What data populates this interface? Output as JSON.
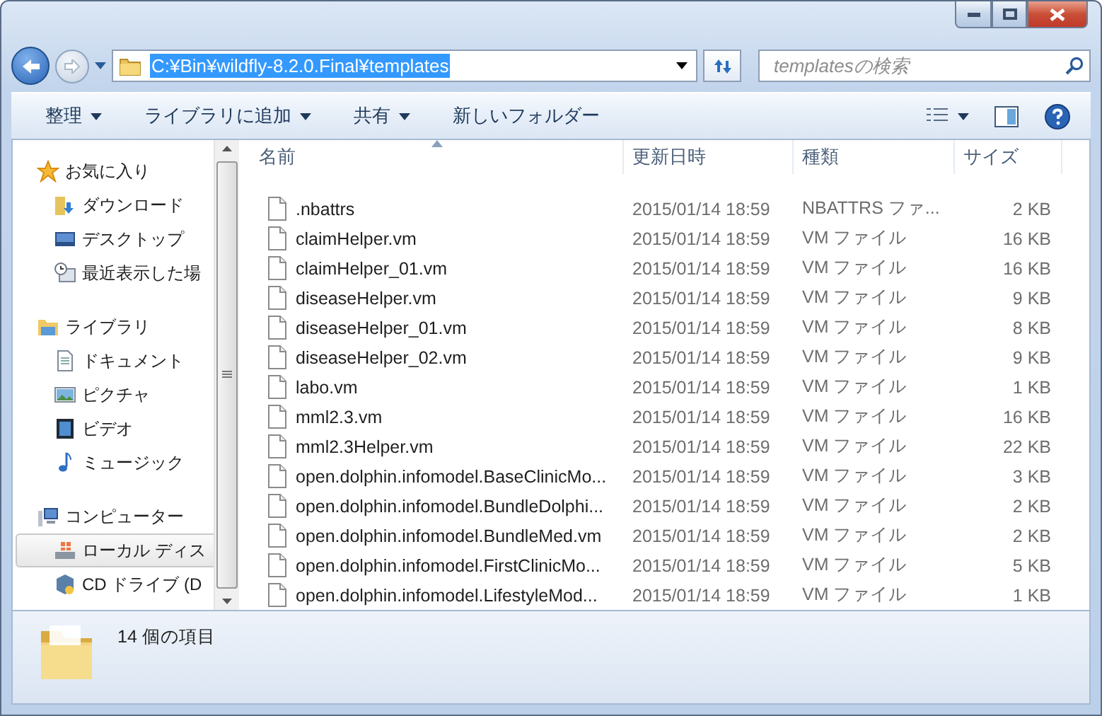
{
  "address": {
    "path": "C:¥Bin¥wildfly-8.2.0.Final¥templates"
  },
  "search": {
    "placeholder": "templatesの検索"
  },
  "toolbar": {
    "items": [
      {
        "label": "整理",
        "dropdown": true
      },
      {
        "label": "ライブラリに追加",
        "dropdown": true
      },
      {
        "label": "共有",
        "dropdown": true
      },
      {
        "label": "新しいフォルダー",
        "dropdown": false
      }
    ]
  },
  "sidebar": {
    "groups": [
      {
        "label": "お気に入り",
        "items": [
          {
            "label": "ダウンロード",
            "selected": false
          },
          {
            "label": "デスクトップ",
            "selected": false
          },
          {
            "label": "最近表示した場",
            "selected": false
          }
        ]
      },
      {
        "label": "ライブラリ",
        "items": [
          {
            "label": "ドキュメント",
            "selected": false
          },
          {
            "label": "ピクチャ",
            "selected": false
          },
          {
            "label": "ビデオ",
            "selected": false
          },
          {
            "label": "ミュージック",
            "selected": false
          }
        ]
      },
      {
        "label": "コンピューター",
        "items": [
          {
            "label": "ローカル ディス",
            "selected": true
          },
          {
            "label": "CD ドライブ (D",
            "selected": false
          }
        ]
      }
    ]
  },
  "table": {
    "columns": [
      {
        "label": "名前",
        "sorted": true
      },
      {
        "label": "更新日時",
        "sorted": false
      },
      {
        "label": "種類",
        "sorted": false
      },
      {
        "label": "サイズ",
        "sorted": false
      }
    ],
    "rows": [
      {
        "name": ".nbattrs",
        "date": "2015/01/14 18:59",
        "type": "NBATTRS ファ...",
        "size": "2 KB"
      },
      {
        "name": "claimHelper.vm",
        "date": "2015/01/14 18:59",
        "type": "VM ファイル",
        "size": "16 KB"
      },
      {
        "name": "claimHelper_01.vm",
        "date": "2015/01/14 18:59",
        "type": "VM ファイル",
        "size": "16 KB"
      },
      {
        "name": "diseaseHelper.vm",
        "date": "2015/01/14 18:59",
        "type": "VM ファイル",
        "size": "9 KB"
      },
      {
        "name": "diseaseHelper_01.vm",
        "date": "2015/01/14 18:59",
        "type": "VM ファイル",
        "size": "8 KB"
      },
      {
        "name": "diseaseHelper_02.vm",
        "date": "2015/01/14 18:59",
        "type": "VM ファイル",
        "size": "9 KB"
      },
      {
        "name": "labo.vm",
        "date": "2015/01/14 18:59",
        "type": "VM ファイル",
        "size": "1 KB"
      },
      {
        "name": "mml2.3.vm",
        "date": "2015/01/14 18:59",
        "type": "VM ファイル",
        "size": "16 KB"
      },
      {
        "name": "mml2.3Helper.vm",
        "date": "2015/01/14 18:59",
        "type": "VM ファイル",
        "size": "22 KB"
      },
      {
        "name": "open.dolphin.infomodel.BaseClinicMo...",
        "date": "2015/01/14 18:59",
        "type": "VM ファイル",
        "size": "3 KB"
      },
      {
        "name": "open.dolphin.infomodel.BundleDolphi...",
        "date": "2015/01/14 18:59",
        "type": "VM ファイル",
        "size": "2 KB"
      },
      {
        "name": "open.dolphin.infomodel.BundleMed.vm",
        "date": "2015/01/14 18:59",
        "type": "VM ファイル",
        "size": "2 KB"
      },
      {
        "name": "open.dolphin.infomodel.FirstClinicMo...",
        "date": "2015/01/14 18:59",
        "type": "VM ファイル",
        "size": "5 KB"
      },
      {
        "name": "open.dolphin.infomodel.LifestyleMod...",
        "date": "2015/01/14 18:59",
        "type": "VM ファイル",
        "size": "1 KB"
      }
    ]
  },
  "status_bar": {
    "text": "14 個の項目"
  }
}
